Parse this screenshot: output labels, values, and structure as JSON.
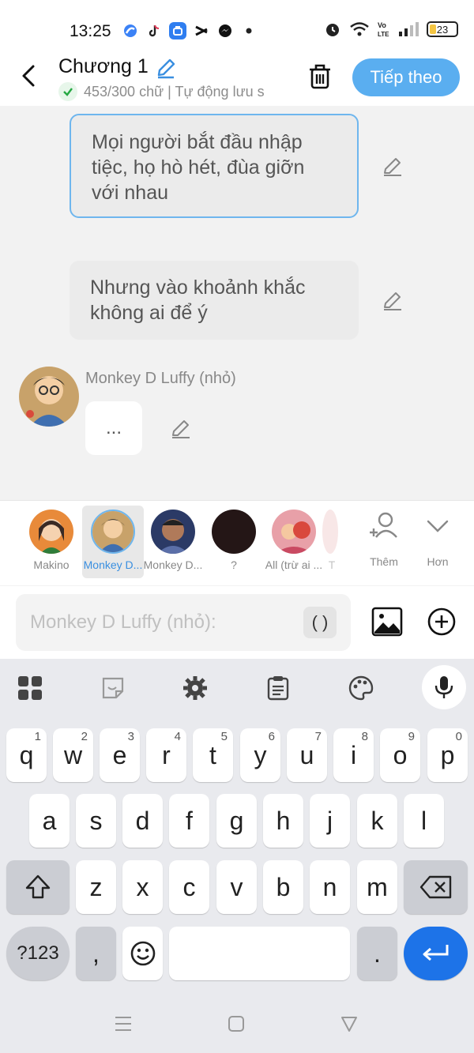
{
  "status_bar": {
    "time": "13:25",
    "battery": "23",
    "apps": [
      "browser-icon",
      "tiktok-icon",
      "store-icon",
      "capcut-icon",
      "messenger-icon",
      "dot-icon"
    ],
    "right_icons": [
      "alarm-icon",
      "wifi-icon",
      "volte-icon",
      "signal-icon",
      "battery-icon"
    ]
  },
  "header": {
    "title": "Chương 1",
    "save_status": "453/300 chữ | Tự động lưu s",
    "next_label": "Tiếp theo"
  },
  "chat": {
    "messages": [
      {
        "text": "Mọi người bắt đầu nhập tiệc, họ hò hét, đùa giỡn với nhau",
        "selected": true
      },
      {
        "text": "Nhưng vào khoảnh khắc không ai để ý",
        "selected": false
      }
    ],
    "speaker_name": "Monkey D Luffy (nhỏ)",
    "speaker_message": "..."
  },
  "characters": [
    {
      "label": "Makino",
      "active": false
    },
    {
      "label": "Monkey D...",
      "active": true
    },
    {
      "label": "Monkey D...",
      "active": false
    },
    {
      "label": "?",
      "active": false
    },
    {
      "label": "All (trừ ai ...",
      "active": false
    },
    {
      "label": "T",
      "active": false
    }
  ],
  "char_actions": {
    "add_label": "Thêm",
    "more_label": "Hơn"
  },
  "input": {
    "placeholder": "Monkey D Luffy (nhỏ):",
    "paren_label": "( )"
  },
  "keyboard": {
    "row1": [
      {
        "k": "q",
        "h": "1"
      },
      {
        "k": "w",
        "h": "2"
      },
      {
        "k": "e",
        "h": "3"
      },
      {
        "k": "r",
        "h": "4"
      },
      {
        "k": "t",
        "h": "5"
      },
      {
        "k": "y",
        "h": "6"
      },
      {
        "k": "u",
        "h": "7"
      },
      {
        "k": "i",
        "h": "8"
      },
      {
        "k": "o",
        "h": "9"
      },
      {
        "k": "p",
        "h": "0"
      }
    ],
    "row2": [
      "a",
      "s",
      "d",
      "f",
      "g",
      "h",
      "j",
      "k",
      "l"
    ],
    "row3": [
      "z",
      "x",
      "c",
      "v",
      "b",
      "n",
      "m"
    ],
    "symbols_label": "?123",
    "comma": ",",
    "period": "."
  },
  "colors": {
    "accent": "#5aaef0",
    "enter": "#1d73e8",
    "selected_border": "#6eb6ee"
  }
}
